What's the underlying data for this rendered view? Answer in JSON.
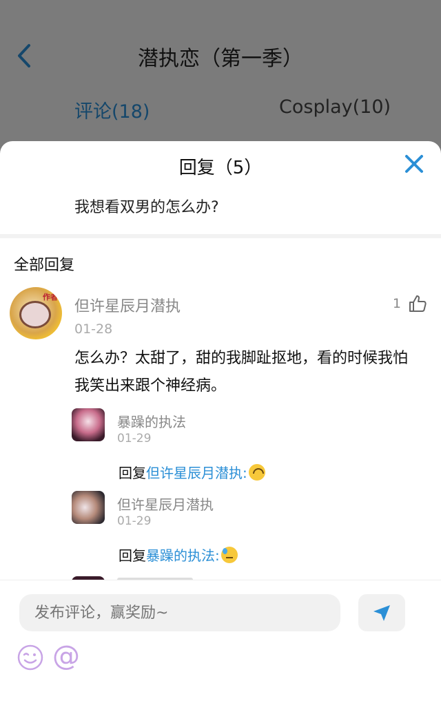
{
  "background": {
    "title": "潜执恋（第一季）",
    "tabs": [
      {
        "label": "评论(18)",
        "active": true
      },
      {
        "label": "Cosplay(10)",
        "active": false
      }
    ]
  },
  "sheet": {
    "title": "回复（5）",
    "topic": "我想看双男的怎么办?",
    "section_label": "全部回复"
  },
  "comment": {
    "author": "但许星辰月潜执",
    "badge": "作者",
    "date": "01-28",
    "likes": "1",
    "text": "怎么办？太甜了，甜的我脚趾抠地，看的时候我怕我笑出来跟个神经病。"
  },
  "replies": [
    {
      "author": "暴躁的执法",
      "date": "01-29",
      "prefix": "回复",
      "mention": "但许星辰月潜执:",
      "emoji": "upside-down-face"
    },
    {
      "author": "但许星辰月潜执",
      "date": "01-29",
      "prefix": "回复",
      "mention": "暴躁的执法:",
      "emoji": "downcast-sweat-face"
    }
  ],
  "composer": {
    "placeholder": "发布评论，赢奖励~",
    "at_symbol": "@"
  },
  "colors": {
    "accent": "#2b8fd6",
    "mention": "#2b8fd6",
    "emoji_accent": "#c8a4e6"
  }
}
